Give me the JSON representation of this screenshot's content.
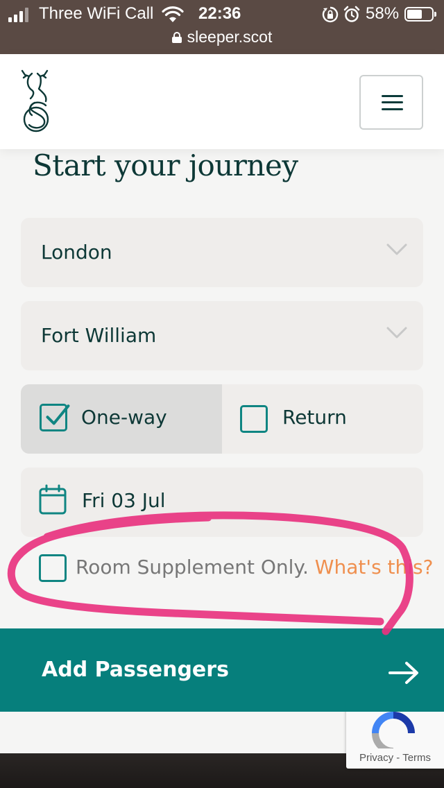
{
  "status_bar": {
    "carrier": "Three WiFi Call",
    "time": "22:36",
    "battery": "58%",
    "url": "sleeper.scot",
    "icons": [
      "signal-icon",
      "wifi-icon",
      "rotation-lock-icon",
      "alarm-icon",
      "battery-icon",
      "lock-icon"
    ]
  },
  "header": {
    "logo": "stag-s-logo",
    "menu_icon": "hamburger-menu-icon"
  },
  "main": {
    "title": "Start your journey",
    "from": {
      "value": "London",
      "icon": "chevron-down-icon"
    },
    "to": {
      "value": "Fort William",
      "icon": "chevron-down-icon"
    },
    "trip_type": {
      "options": [
        {
          "label": "One-way",
          "checked": true
        },
        {
          "label": "Return",
          "checked": false
        }
      ]
    },
    "date": {
      "value": "Fri 03 Jul",
      "icon": "calendar-icon"
    },
    "supplement": {
      "label": "Room Supplement Only.",
      "link": "What's this?",
      "checked": false
    },
    "cta": {
      "label": "Add Passengers",
      "icon": "arrow-right-icon"
    }
  },
  "recaptcha": {
    "privacy": "Privacy",
    "separator": " - ",
    "terms": "Terms"
  },
  "colors": {
    "teal": "#067f7c",
    "dark_green": "#0d3836",
    "orange_link": "#ef8f4e",
    "field_bg": "#efedeb",
    "annotation_pink": "#e8337f"
  }
}
